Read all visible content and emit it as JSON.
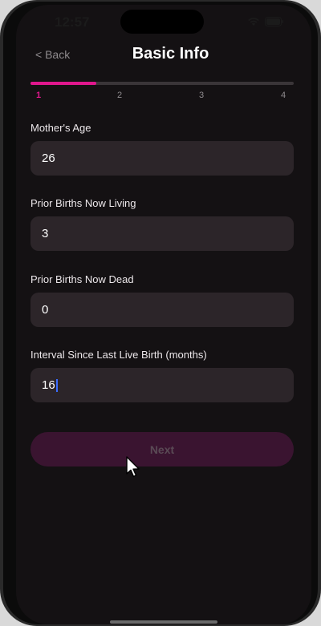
{
  "status_bar": {
    "time": "12:57",
    "wifi_icon": "wifi-icon",
    "battery_icon": "battery-icon"
  },
  "nav": {
    "back_label": "< Back",
    "title": "Basic Info"
  },
  "stepper": {
    "steps": [
      "1",
      "2",
      "3",
      "4"
    ],
    "current_step": 1,
    "progress_fraction": 0.25,
    "accent_color": "#e0178d",
    "track_color": "#3a3538"
  },
  "form": {
    "fields": [
      {
        "label": "Mother's Age",
        "value": "26"
      },
      {
        "label": "Prior Births Now Living",
        "value": "3"
      },
      {
        "label": "Prior Births Now Dead",
        "value": "0"
      },
      {
        "label": "Interval Since Last Live Birth (months)",
        "value": "16"
      }
    ]
  },
  "actions": {
    "next_label": "Next",
    "next_enabled": false
  },
  "colors": {
    "background": "#141113",
    "input_background": "#2c2529",
    "button_disabled_background": "#3a1430",
    "caret": "#3b6cff"
  }
}
